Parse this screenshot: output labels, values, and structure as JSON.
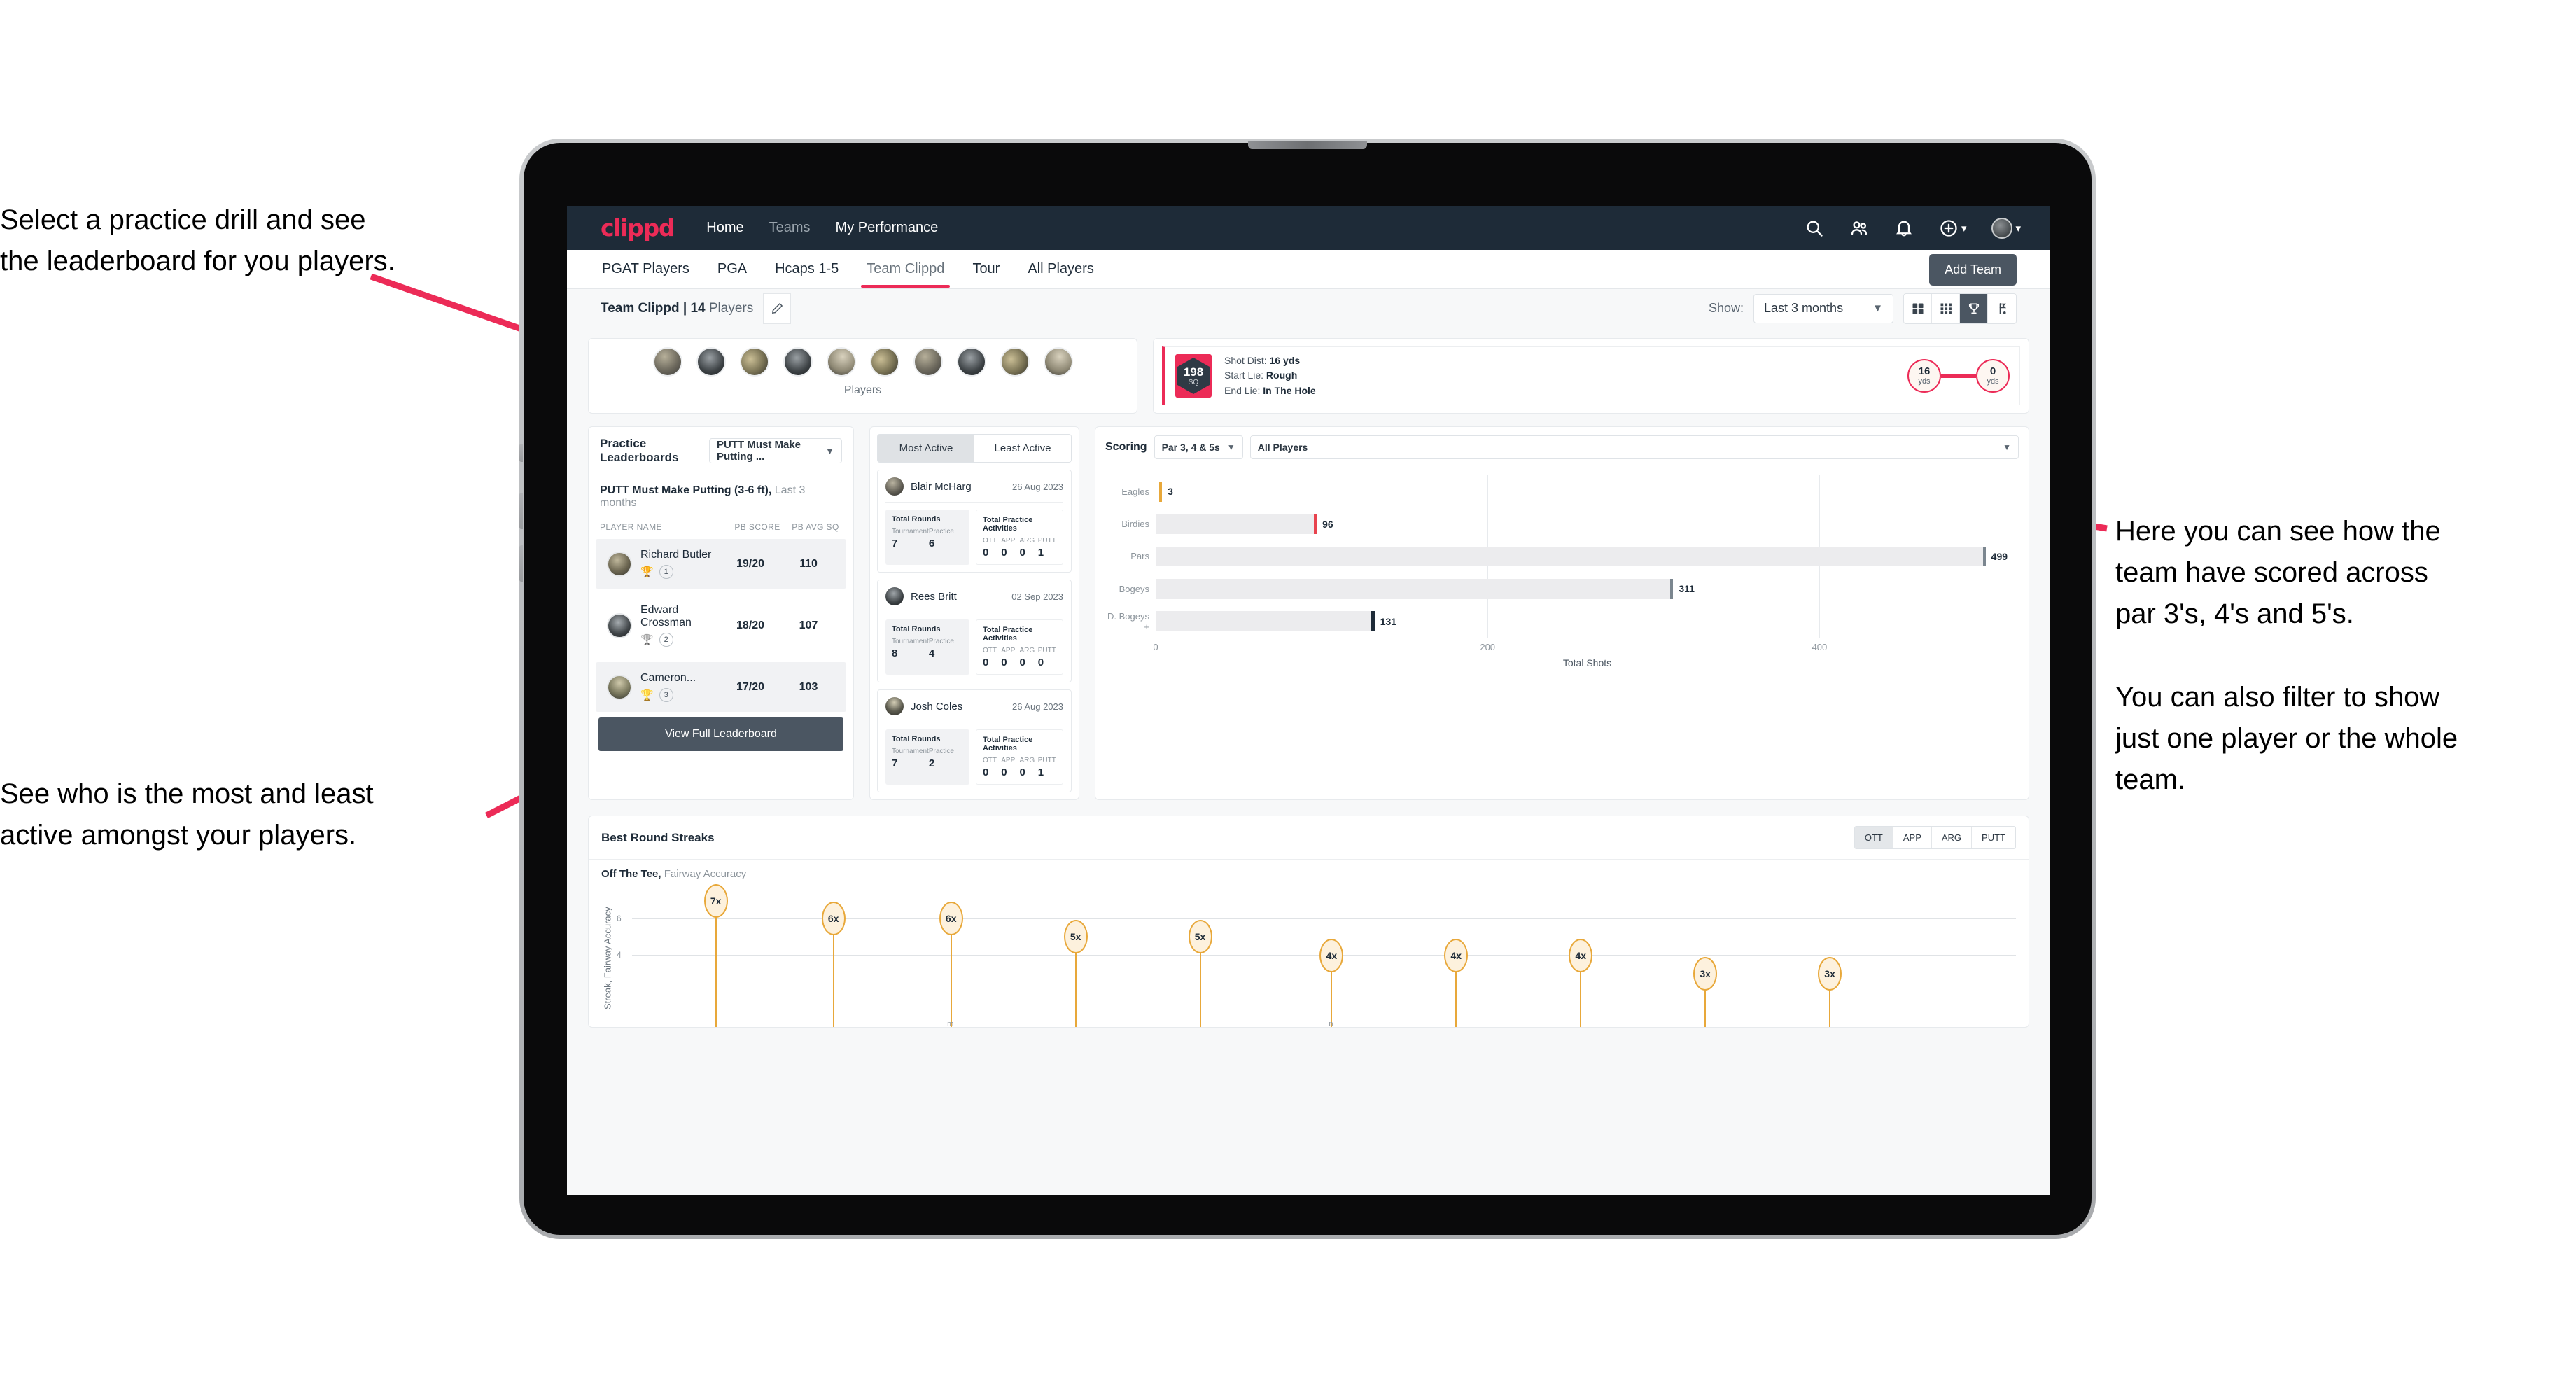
{
  "annotations": {
    "left_top": "Select a practice drill and see\nthe leaderboard for you players.",
    "left_bottom": "See who is the most and least\nactive amongst your players.",
    "right": "Here you can see how the\nteam have scored across\npar 3's, 4's and 5's.\n\nYou can also filter to show\njust one player or the whole\nteam.",
    "accent_color": "#ec2b57"
  },
  "navbar": {
    "logo": "clippd",
    "links": [
      {
        "label": "Home",
        "active": true
      },
      {
        "label": "Teams",
        "active": false
      },
      {
        "label": "My Performance",
        "active": true
      }
    ],
    "icons": [
      "search-icon",
      "people-icon",
      "bell-icon",
      "plus-circle-icon",
      "avatar"
    ]
  },
  "tabs": [
    {
      "label": "PGAT Players",
      "active": false
    },
    {
      "label": "PGA",
      "active": false
    },
    {
      "label": "Hcaps 1-5",
      "active": false
    },
    {
      "label": "Team Clippd",
      "active": true
    },
    {
      "label": "Tour",
      "active": false
    },
    {
      "label": "All Players",
      "active": false
    }
  ],
  "add_team_button": "Add Team",
  "team_bar": {
    "team_name": "Team Clippd | 14",
    "players_suffix": " Players",
    "edit_icon": "pencil-icon",
    "show_label": "Show:",
    "range_value": "Last 3 months",
    "view_toggles": [
      "grid-large-icon",
      "grid-small-icon",
      "trophy-icon",
      "flag-icon"
    ],
    "active_toggle": "trophy-icon"
  },
  "players_strip": {
    "label": "Players",
    "count": 10
  },
  "shot_card": {
    "sq_value": "198",
    "sq_unit": "SQ",
    "lines": [
      {
        "label": "Shot Dist:",
        "value": "16 yds"
      },
      {
        "label": "Start Lie:",
        "value": "Rough"
      },
      {
        "label": "End Lie:",
        "value": "In The Hole"
      }
    ],
    "start_dist": "16",
    "start_unit": "yds",
    "end_dist": "0",
    "end_unit": "yds"
  },
  "leaderboard": {
    "title": "Practice Leaderboards",
    "drill_select": "PUTT Must Make Putting ...",
    "subtitle_bold": "PUTT Must Make Putting (3-6 ft),",
    "subtitle_rest": " Last 3 months",
    "columns": {
      "name": "PLAYER NAME",
      "score": "PB SCORE",
      "avg": "PB AVG SQ"
    },
    "rows": [
      {
        "name": "Richard Butler",
        "rank": "1",
        "trophy": "gold",
        "score": "19/20",
        "avg": "110"
      },
      {
        "name": "Edward Crossman",
        "rank": "2",
        "trophy": "silver",
        "score": "18/20",
        "avg": "107"
      },
      {
        "name": "Cameron...",
        "rank": "3",
        "trophy": "bronze",
        "score": "17/20",
        "avg": "103"
      }
    ],
    "button": "View Full Leaderboard"
  },
  "activity": {
    "tabs": [
      {
        "label": "Most Active",
        "active": true
      },
      {
        "label": "Least Active",
        "active": false
      }
    ],
    "rounds_title": "Total Rounds",
    "acts_title": "Total Practice Activities",
    "rounds_cols": [
      "Tournament",
      "Practice"
    ],
    "acts_cols": [
      "OTT",
      "APP",
      "ARG",
      "PUTT"
    ],
    "items": [
      {
        "name": "Blair McHarg",
        "date": "26 Aug 2023",
        "tournament": "7",
        "practice": "6",
        "ott": "0",
        "app": "0",
        "arg": "0",
        "putt": "1"
      },
      {
        "name": "Rees Britt",
        "date": "02 Sep 2023",
        "tournament": "8",
        "practice": "4",
        "ott": "0",
        "app": "0",
        "arg": "0",
        "putt": "0"
      },
      {
        "name": "Josh Coles",
        "date": "26 Aug 2023",
        "tournament": "7",
        "practice": "2",
        "ott": "0",
        "app": "0",
        "arg": "0",
        "putt": "1"
      }
    ]
  },
  "scoring": {
    "title": "Scoring",
    "par_select": "Par 3, 4 & 5s",
    "player_select": "All Players"
  },
  "streaks": {
    "title": "Best Round Streaks",
    "tabs": [
      {
        "label": "OTT",
        "active": true
      },
      {
        "label": "APP",
        "active": false
      },
      {
        "label": "ARG",
        "active": false
      },
      {
        "label": "PUTT",
        "active": false
      }
    ],
    "sub_bold": "Off The Tee,",
    "sub_rest": " Fairway Accuracy"
  },
  "chart_data": [
    {
      "type": "bar",
      "orientation": "horizontal",
      "title": "Scoring",
      "categories": [
        "Eagles",
        "Birdies",
        "Pars",
        "Bogeys",
        "D. Bogeys +"
      ],
      "values": [
        3,
        96,
        499,
        311,
        131
      ],
      "cap_colors": [
        "#e8a83a",
        "#e8434e",
        "#7b868f",
        "#7b868f",
        "#1e2b38"
      ],
      "xlabel": "Total Shots",
      "ylabel": "",
      "xlim": [
        0,
        520
      ],
      "xticks": [
        0,
        200,
        400
      ],
      "grid": true,
      "legend": "none"
    },
    {
      "type": "bar",
      "orientation": "vertical-lollipop",
      "title": "Off The Tee, Fairway Accuracy",
      "categories": [
        "",
        "",
        "m",
        "",
        "",
        "n",
        "",
        "",
        "",
        ""
      ],
      "values": [
        7,
        6,
        6,
        5,
        5,
        4,
        4,
        4,
        3,
        3
      ],
      "labels": [
        "7x",
        "6x",
        "6x",
        "5x",
        "5x",
        "4x",
        "4x",
        "4x",
        "3x",
        "3x"
      ],
      "ylabel": "Streak, Fairway Accuracy",
      "xlabel": "",
      "ylim": [
        0,
        7.6
      ],
      "yticks": [
        4,
        6
      ],
      "grid": true,
      "legend": "none",
      "marker_color": "#e8a83a",
      "marker_fill": "#fdf1dd"
    }
  ]
}
